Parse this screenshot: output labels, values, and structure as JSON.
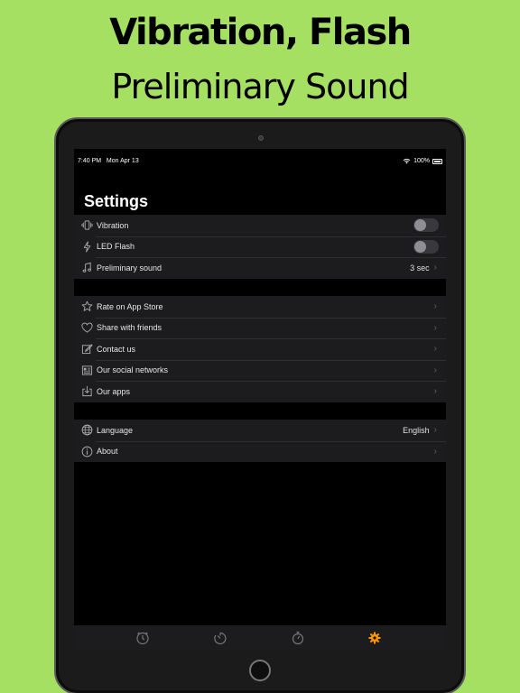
{
  "promo": {
    "line1": "Vibration, Flash",
    "line2": "Preliminary Sound"
  },
  "status": {
    "time": "7:40 PM",
    "date": "Mon Apr 13",
    "battery": "100%"
  },
  "settings": {
    "title": "Settings",
    "group1": [
      {
        "icon": "vibration-icon",
        "label": "Vibration",
        "toggle": false
      },
      {
        "icon": "flash-icon",
        "label": "LED Flash",
        "toggle": false
      },
      {
        "icon": "music-note-icon",
        "label": "Preliminary sound",
        "value": "3 sec"
      }
    ],
    "group2": [
      {
        "icon": "star-icon",
        "label": "Rate on App Store"
      },
      {
        "icon": "heart-icon",
        "label": "Share with friends"
      },
      {
        "icon": "compose-icon",
        "label": "Contact us"
      },
      {
        "icon": "news-icon",
        "label": "Our social networks"
      },
      {
        "icon": "download-icon",
        "label": "Our apps"
      }
    ],
    "group3": [
      {
        "icon": "globe-icon",
        "label": "Language",
        "value": "English"
      },
      {
        "icon": "info-icon",
        "label": "About"
      }
    ]
  },
  "tabs": [
    {
      "icon": "clock-icon"
    },
    {
      "icon": "timer-icon"
    },
    {
      "icon": "stopwatch-icon"
    },
    {
      "icon": "gear-icon",
      "active": true
    }
  ],
  "colors": {
    "background": "#a6e063",
    "accent": "#ff9500"
  }
}
